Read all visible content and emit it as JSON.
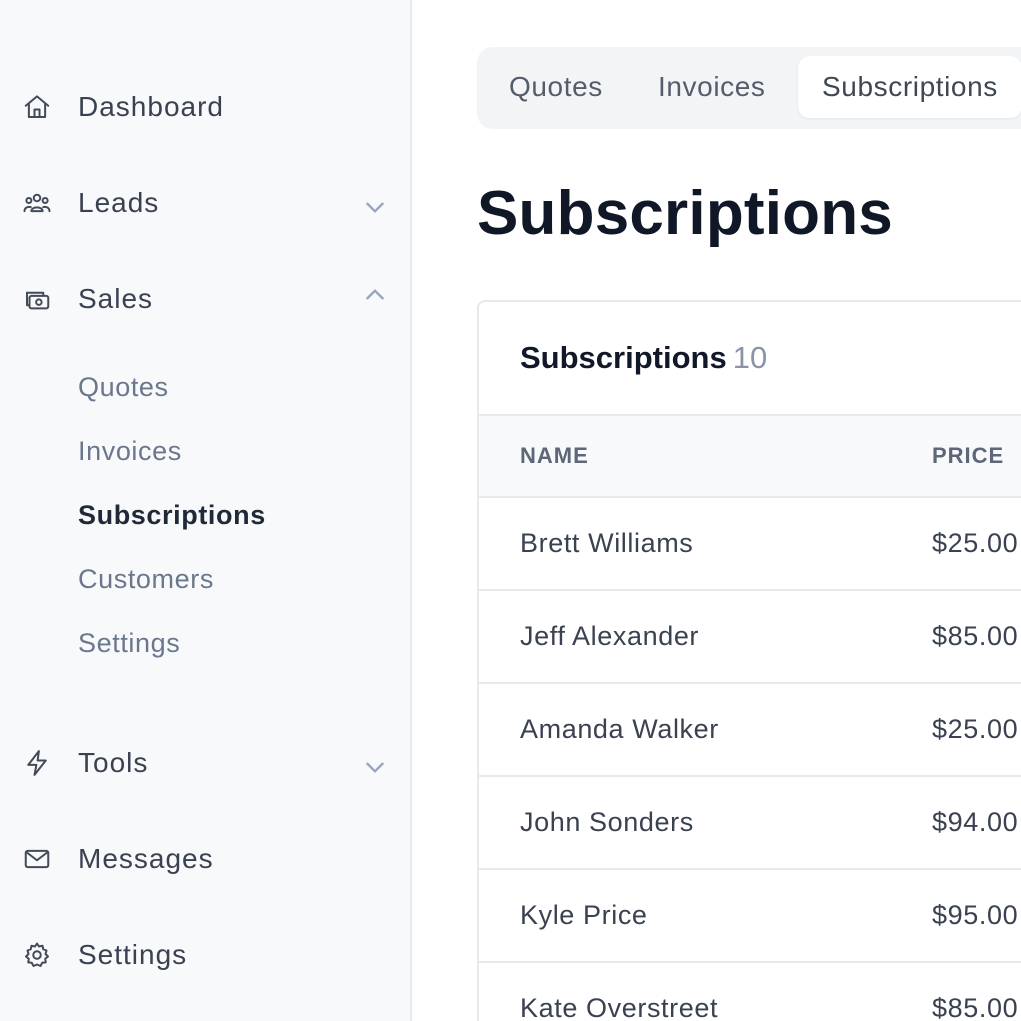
{
  "sidebar": {
    "items": [
      {
        "label": "Dashboard",
        "icon": "home-icon"
      },
      {
        "label": "Leads",
        "icon": "users-icon",
        "expanded": false
      },
      {
        "label": "Sales",
        "icon": "cash-icon",
        "expanded": true
      },
      {
        "label": "Tools",
        "icon": "bolt-icon",
        "expanded": false
      },
      {
        "label": "Messages",
        "icon": "mail-icon"
      },
      {
        "label": "Settings",
        "icon": "gear-icon"
      }
    ],
    "sales_sub": [
      {
        "label": "Quotes"
      },
      {
        "label": "Invoices"
      },
      {
        "label": "Subscriptions",
        "active": true
      },
      {
        "label": "Customers"
      },
      {
        "label": "Settings"
      }
    ]
  },
  "tabs": [
    {
      "label": "Quotes"
    },
    {
      "label": "Invoices"
    },
    {
      "label": "Subscriptions",
      "active": true
    }
  ],
  "page_title": "Subscriptions",
  "card": {
    "title": "Subscriptions",
    "count": "10",
    "columns": [
      "NAME",
      "PRICE"
    ],
    "rows": [
      {
        "name": "Brett Williams",
        "price": "$25.00"
      },
      {
        "name": "Jeff Alexander",
        "price": "$85.00"
      },
      {
        "name": "Amanda Walker",
        "price": "$25.00"
      },
      {
        "name": "John Sonders",
        "price": "$94.00"
      },
      {
        "name": "Kyle Price",
        "price": "$95.00"
      },
      {
        "name": "Kate Overstreet",
        "price": "$85.00"
      }
    ]
  },
  "colors": {
    "sidebar_bg": "#f7f9fb",
    "active_text": "#1f2937",
    "muted_text": "#6b778c"
  }
}
